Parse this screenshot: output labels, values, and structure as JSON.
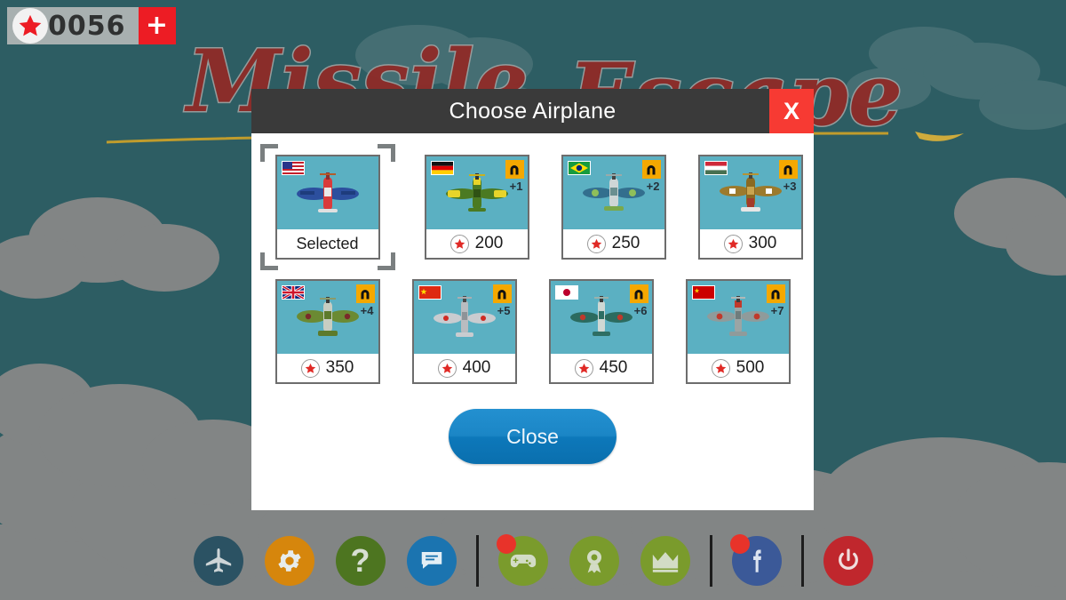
{
  "background": {
    "sky_color": "#2d5d63",
    "cloud_color": "#828585",
    "logo_text_line1": "Missile",
    "logo_text_line2": "Escape",
    "logo_color": "#8f2b28"
  },
  "hud": {
    "star_icon": "star-icon",
    "star_count": "0056",
    "add_label": "+",
    "add_color": "#ed1c24"
  },
  "dialog": {
    "title": "Choose Airplane",
    "close_x_label": "X",
    "close_x_color": "#f73a33",
    "header_color": "#3a3a3a",
    "close_button_label": "Close",
    "close_button_color": "#1b86c6"
  },
  "airplanes": [
    {
      "country": "United States",
      "flag": "us-flag-icon",
      "status_label": "Selected",
      "price": null,
      "bonus": null,
      "magnet_icon": null,
      "selected": true,
      "plane_body": "#d93b3b",
      "plane_wing": "#2c4f9e"
    },
    {
      "country": "Germany",
      "flag": "de-flag-icon",
      "status_label": null,
      "price": "200",
      "bonus": "+1",
      "magnet_icon": "magnet-icon",
      "selected": false,
      "plane_body": "#4b7a22",
      "plane_wing": "#e8d42a"
    },
    {
      "country": "Brazil",
      "flag": "br-flag-icon",
      "status_label": null,
      "price": "250",
      "bonus": "+2",
      "magnet_icon": "magnet-icon",
      "selected": false,
      "plane_body": "#3f7f7a",
      "plane_wing": "#336f8e"
    },
    {
      "country": "Hungary",
      "flag": "hu-flag-icon",
      "status_label": null,
      "price": "300",
      "bonus": "+3",
      "magnet_icon": "magnet-icon",
      "selected": false,
      "plane_body": "#8a6a22",
      "plane_wing": "#9c7a2c"
    },
    {
      "country": "United Kingdom",
      "flag": "gb-flag-icon",
      "status_label": null,
      "price": "350",
      "bonus": "+4",
      "magnet_icon": "magnet-icon",
      "selected": false,
      "plane_body": "#5d7a2b",
      "plane_wing": "#6b8a33"
    },
    {
      "country": "China",
      "flag": "cn-flag-icon",
      "status_label": null,
      "price": "400",
      "bonus": "+5",
      "magnet_icon": "magnet-icon",
      "selected": false,
      "plane_body": "#b9bcc0",
      "plane_wing": "#c9ccd0"
    },
    {
      "country": "Japan",
      "flag": "jp-flag-icon",
      "status_label": null,
      "price": "450",
      "bonus": "+6",
      "magnet_icon": "magnet-icon",
      "selected": false,
      "plane_body": "#2e6e63",
      "plane_wing": "#2b6b5f"
    },
    {
      "country": "Soviet Union",
      "flag": "su-flag-icon",
      "status_label": null,
      "price": "500",
      "bonus": "+7",
      "magnet_icon": "magnet-icon",
      "selected": false,
      "plane_body": "#9aa5a5",
      "plane_wing": "#8f9b9b"
    }
  ],
  "toolbar": [
    {
      "name": "airplane",
      "icon": "airplane-icon",
      "color": "#2b5263",
      "badge": false
    },
    {
      "name": "settings",
      "icon": "gear-icon",
      "color": "#d6860c",
      "badge": false
    },
    {
      "name": "help",
      "icon": "question-icon",
      "color": "#4d7520",
      "badge": false
    },
    {
      "name": "chat",
      "icon": "chat-icon",
      "color": "#1b74b0",
      "badge": false
    },
    {
      "name": "separator-1",
      "icon": "separator",
      "color": "#1d1d1d",
      "badge": false
    },
    {
      "name": "games",
      "icon": "gamepad-icon",
      "color": "#7a9b2c",
      "badge": true
    },
    {
      "name": "achievements",
      "icon": "ribbon-icon",
      "color": "#7a9b2c",
      "badge": false
    },
    {
      "name": "leaderboard",
      "icon": "crown-icon",
      "color": "#7a9b2c",
      "badge": false
    },
    {
      "name": "separator-2",
      "icon": "separator",
      "color": "#1d1d1d",
      "badge": false
    },
    {
      "name": "facebook",
      "icon": "facebook-icon",
      "color": "#3b5998",
      "badge": true
    },
    {
      "name": "separator-3",
      "icon": "separator",
      "color": "#1d1d1d",
      "badge": false
    },
    {
      "name": "exit",
      "icon": "power-icon",
      "color": "#c0272d",
      "badge": false
    }
  ]
}
